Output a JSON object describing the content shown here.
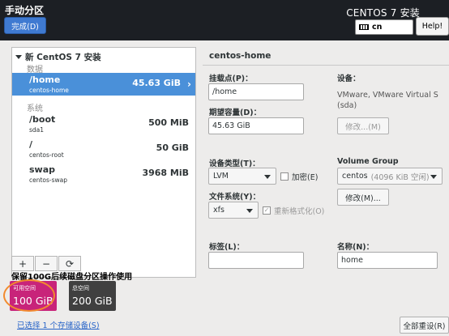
{
  "header": {
    "title": "手动分区",
    "done_label": "完成(D)",
    "product": "CENTOS 7 安装",
    "keyboard_layout": "cn",
    "help_label": "Help!"
  },
  "tree": {
    "install_title": "新 CentOS 7 安装",
    "section_data": "数据",
    "section_system": "系统",
    "mountpoints": [
      {
        "path": "/home",
        "device": "centos-home",
        "size": "45.63 GiB"
      },
      {
        "path": "/boot",
        "device": "sda1",
        "size": "500 MiB"
      },
      {
        "path": "/",
        "device": "centos-root",
        "size": "50 GiB"
      },
      {
        "path": "swap",
        "device": "centos-swap",
        "size": "3968 MiB"
      }
    ],
    "toolbar": {
      "add": "+",
      "remove": "−",
      "refresh": "⟳"
    }
  },
  "reserve_note": "保留100G后续磁盘分区操作使用",
  "space": {
    "available_label": "可用空间",
    "available_value": "100 GiB",
    "total_label": "总空间",
    "total_value": "200 GiB"
  },
  "storage_link": "已选择 1 个存储设备(S)",
  "reset_label": "全部重设(R)",
  "detail": {
    "title": "centos-home",
    "mountpoint_label": "挂载点(P)：",
    "mountpoint_value": "/home",
    "capacity_label": "期望容量(D)：",
    "capacity_value": "45.63 GiB",
    "device_label": "设备：",
    "device_info": "VMware, VMware Virtual S",
    "device_info2": "(sda)",
    "modify_device_label": "修改...(M)",
    "device_type_label": "设备类型(T)：",
    "device_type_value": "LVM",
    "encrypt_label": "加密(E)",
    "filesystem_label": "文件系统(Y)：",
    "filesystem_value": "xfs",
    "reformat_label": "重新格式化(O)",
    "volume_group_label": "Volume Group",
    "volume_group_value": "centos",
    "volume_group_free": "(4096 KiB 空闲)",
    "modify_vg_label": "修改(M)...",
    "tag_label": "标签(L)：",
    "tag_value": "",
    "name_label": "名称(N)：",
    "name_value": "home"
  },
  "colors": {
    "header_bg": "#1c1f24",
    "accent": "#4a90d9",
    "available": "#c8247a",
    "total": "#404040",
    "annotation": "#f28a2e"
  }
}
